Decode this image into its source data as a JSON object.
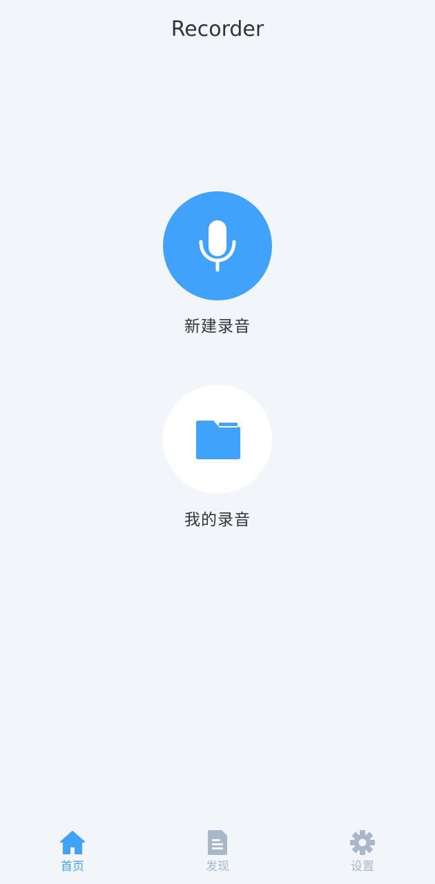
{
  "header": {
    "title": "Recorder"
  },
  "actions": {
    "new_recording": {
      "label": "新建录音",
      "icon": "microphone-icon"
    },
    "my_recordings": {
      "label": "我的录音",
      "icon": "folder-icon"
    }
  },
  "tabbar": {
    "items": [
      {
        "label": "首页",
        "icon": "home-icon",
        "active": true
      },
      {
        "label": "发现",
        "icon": "document-icon",
        "active": false
      },
      {
        "label": "设置",
        "icon": "gear-icon",
        "active": false
      }
    ]
  },
  "colors": {
    "accent": "#41a2fb",
    "background": "#f2f6fb",
    "inactive": "#a9b7c8",
    "text": "#333333"
  }
}
